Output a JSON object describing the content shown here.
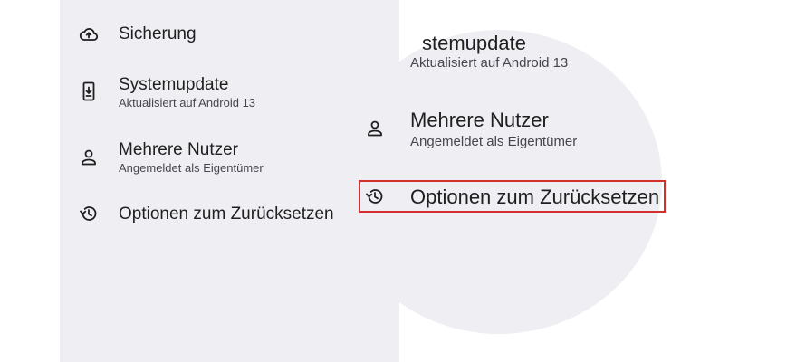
{
  "settings": {
    "items": [
      {
        "title": "Sicherung",
        "subtitle": "",
        "icon": "cloud-upload-icon"
      },
      {
        "title": "Systemupdate",
        "subtitle": "Aktualisiert auf Android 13",
        "icon": "system-update-icon"
      },
      {
        "title": "Mehrere Nutzer",
        "subtitle": "Angemeldet als Eigentümer",
        "icon": "person-icon"
      },
      {
        "title": "Optionen zum Zurücksetzen",
        "subtitle": "",
        "icon": "history-icon"
      }
    ]
  },
  "zoom": {
    "partial_title": "stemupdate",
    "partial_subtitle": "Aktualisiert auf Android 13",
    "user_title": "Mehrere Nutzer",
    "user_subtitle": "Angemeldet als Eigentümer",
    "reset_title": "Optionen zum Zurücksetzen",
    "highlight_color": "#d32f2f"
  },
  "colors": {
    "panel_background": "#efeef3",
    "text": "#1f1f1f",
    "subtext": "#45464f"
  }
}
